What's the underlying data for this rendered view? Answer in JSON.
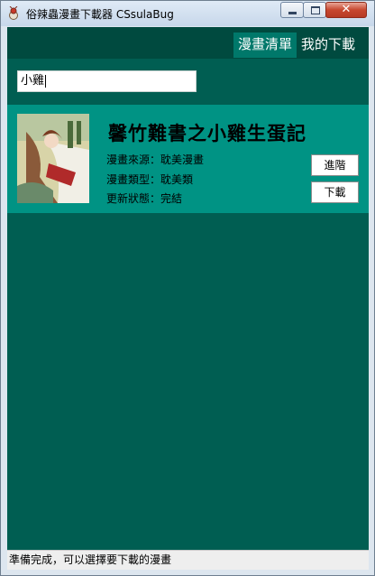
{
  "window": {
    "title": "俗辣蟲漫畫下載器 CSsulaBug"
  },
  "nav": {
    "tabs": [
      {
        "label": "漫畫清單"
      },
      {
        "label": "我的下載"
      }
    ]
  },
  "search": {
    "value": "小雞"
  },
  "result": {
    "title": "馨竹難書之小雞生蛋記",
    "source_label": "漫畫來源：",
    "source": "耽美漫畫",
    "type_label": "漫畫類型：",
    "type": "耽美類",
    "status_label": "更新狀態：",
    "status": "完結",
    "advanced_button": "進階",
    "download_button": "下載"
  },
  "status_bar": {
    "text": "準備完成，可以選擇要下載的漫畫"
  },
  "colors": {
    "primary": "#005e52",
    "navbar": "#004a3f",
    "active_tab": "#00786a",
    "card": "#009384"
  }
}
